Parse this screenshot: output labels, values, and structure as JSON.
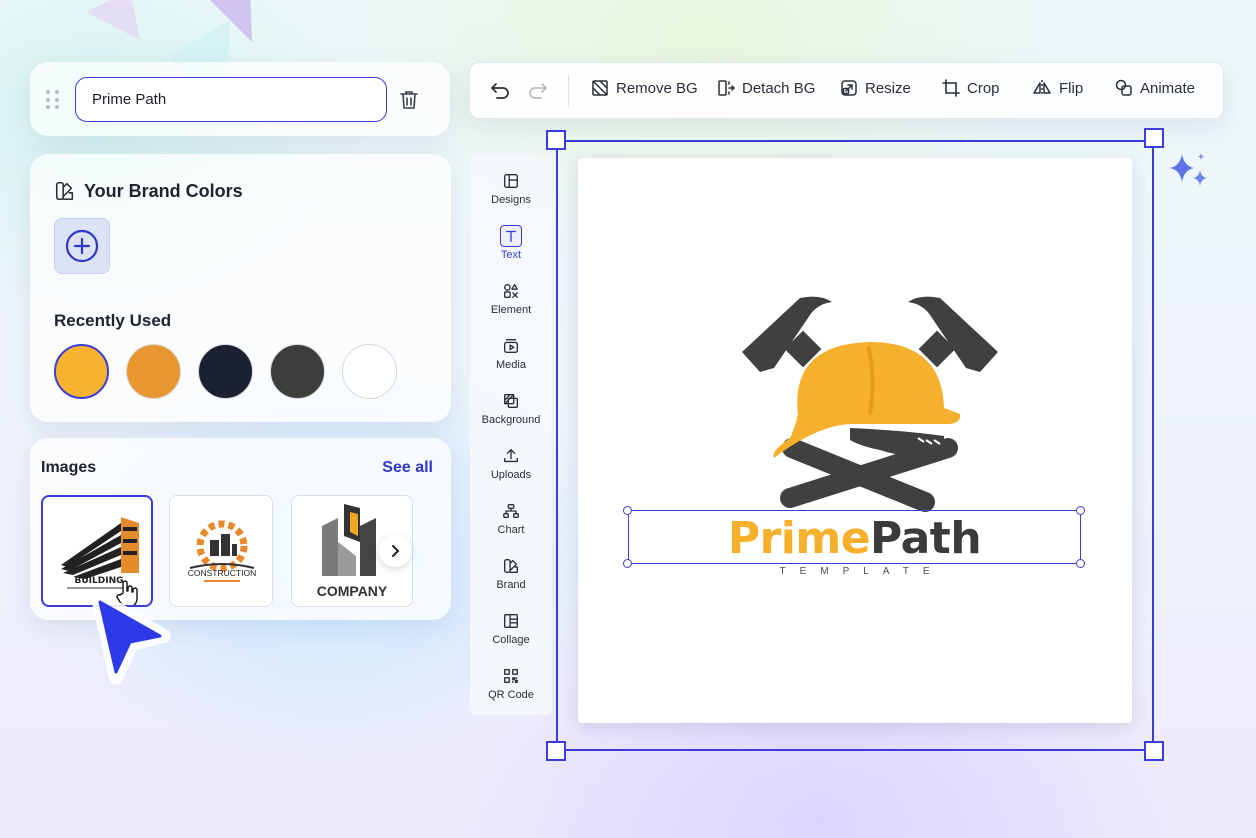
{
  "name_field": {
    "value": "Prime Path"
  },
  "brand_colors": {
    "title": "Your Brand Colors",
    "recent_label": "Recently Used",
    "recent": [
      "#f7b22e",
      "#e8962f",
      "#1b2130",
      "#3d3d3b",
      "#ffffff"
    ],
    "selected_index": 0
  },
  "images": {
    "title": "Images",
    "see_all": "See all",
    "thumbs": [
      {
        "label": "BUILDING",
        "selected": true
      },
      {
        "label": "CONSTRUCTION",
        "selected": false
      },
      {
        "label": "COMPANY",
        "selected": false
      }
    ]
  },
  "toolbar": {
    "remove_bg": "Remove BG",
    "detach_bg": "Detach BG",
    "resize": "Resize",
    "crop": "Crop",
    "flip": "Flip",
    "animate": "Animate"
  },
  "tools": [
    {
      "label": "Designs",
      "icon": "layout-icon"
    },
    {
      "label": "Text",
      "icon": "text-icon",
      "active": true
    },
    {
      "label": "Element",
      "icon": "shapes-icon"
    },
    {
      "label": "Media",
      "icon": "media-icon"
    },
    {
      "label": "Background",
      "icon": "background-icon"
    },
    {
      "label": "Uploads",
      "icon": "upload-icon"
    },
    {
      "label": "Chart",
      "icon": "chart-icon"
    },
    {
      "label": "Brand",
      "icon": "brand-icon"
    },
    {
      "label": "Collage",
      "icon": "collage-icon"
    },
    {
      "label": "QR Code",
      "icon": "qr-code-icon"
    }
  ],
  "logo": {
    "word1": "Prime",
    "word2": "Path",
    "tagline": "TEMPLATE",
    "accent": "#f6b02c",
    "dark": "#3b3b3b"
  },
  "colors": {
    "primary": "#3b3dd8"
  }
}
